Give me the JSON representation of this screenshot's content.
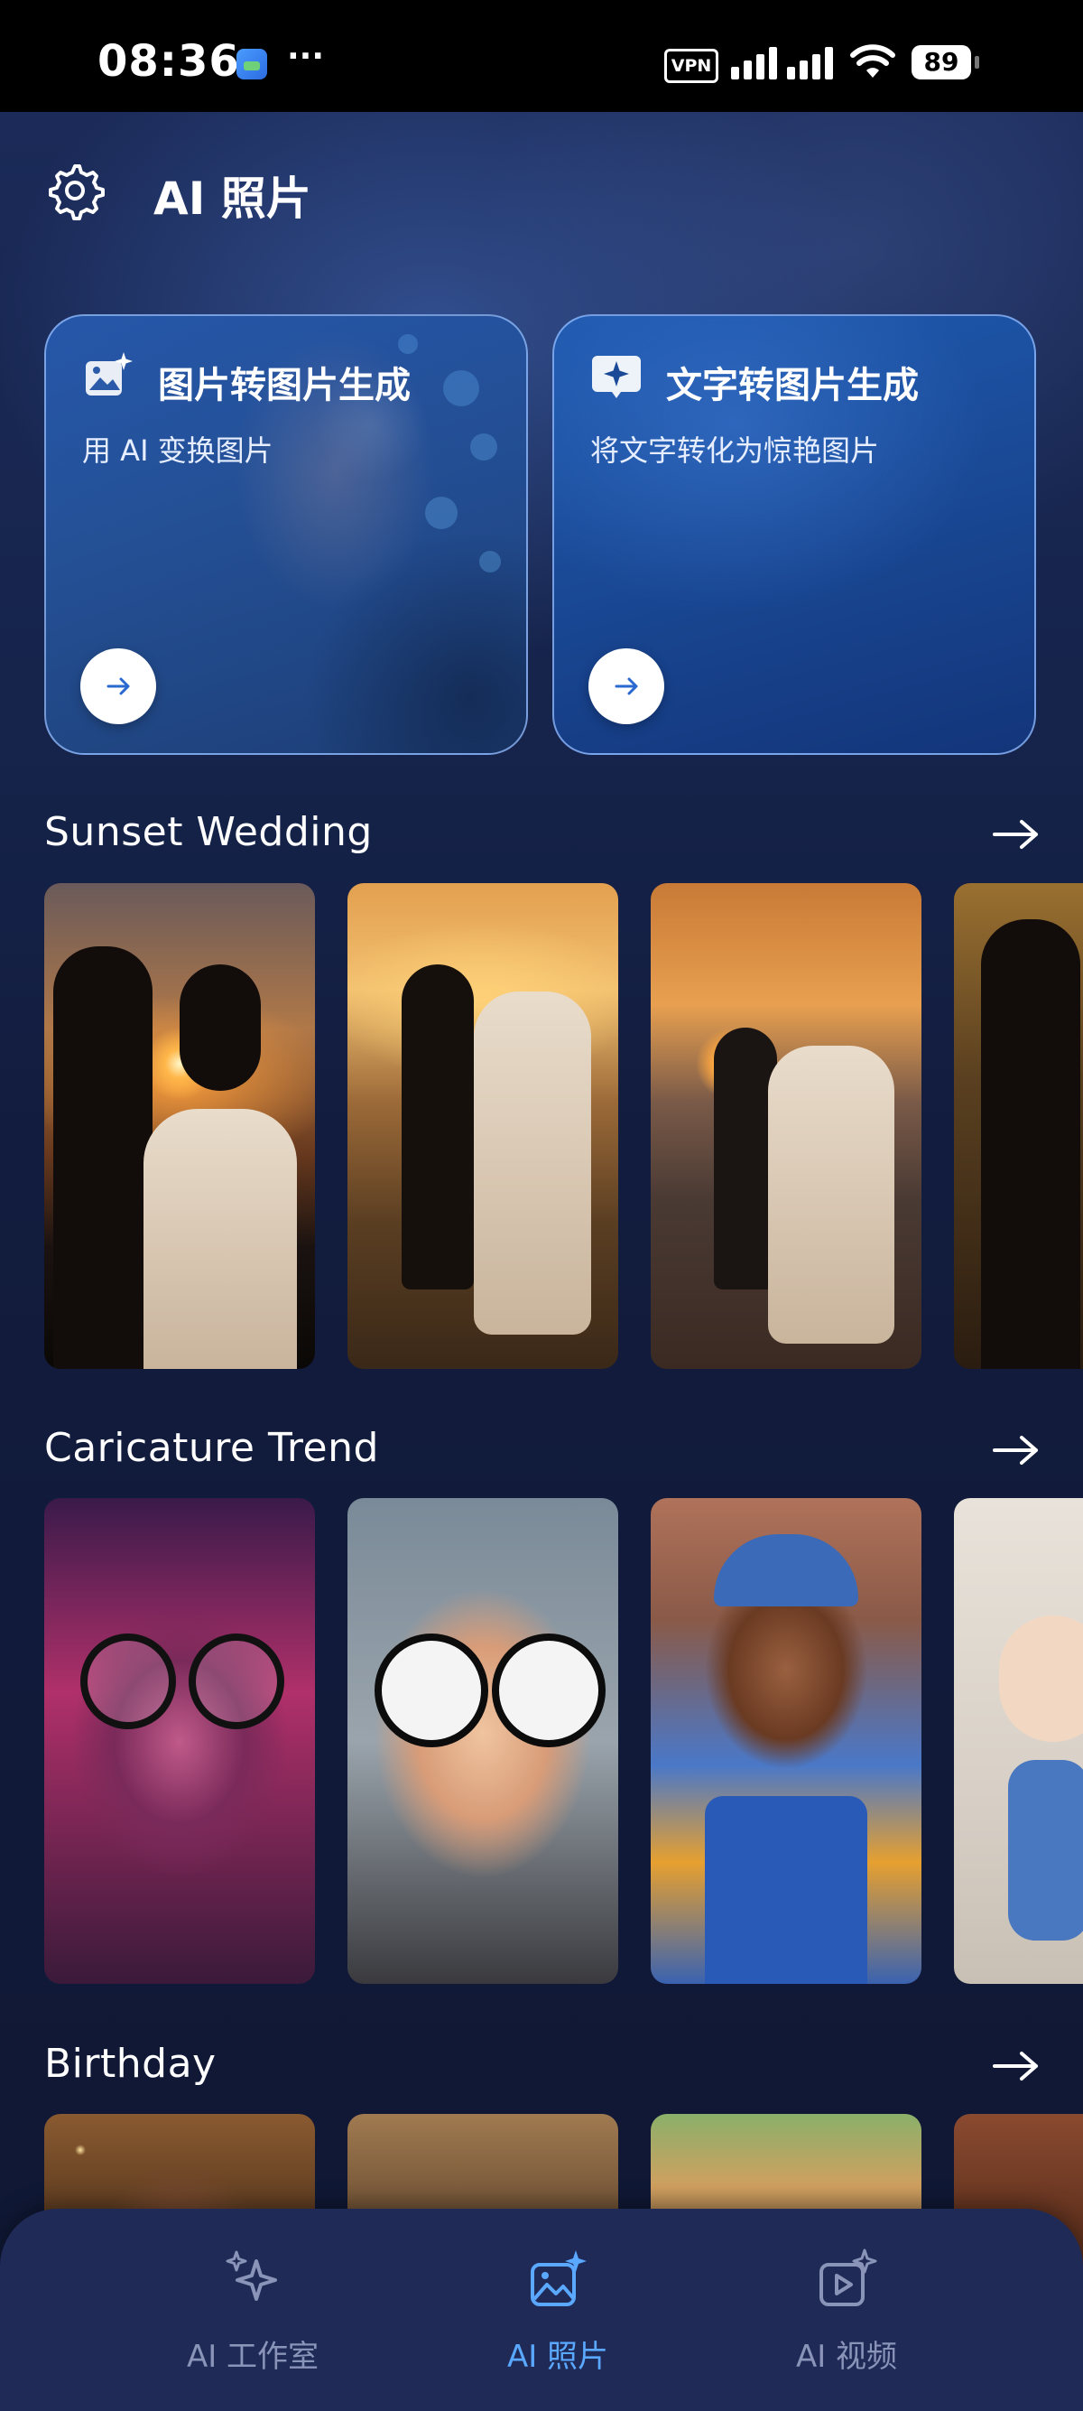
{
  "status_bar": {
    "time": "08:36",
    "more_indicator": "···",
    "vpn_label": "VPN",
    "battery_level": "89",
    "icons": [
      "app-notification-icon",
      "vpn-icon",
      "signal-icon",
      "wifi-icon",
      "battery-icon"
    ]
  },
  "header": {
    "title": "AI 照片",
    "settings_icon": "gear-icon"
  },
  "feature_cards": [
    {
      "title": "图片转图片生成",
      "subtitle": "用 AI 变换图片",
      "icon": "image-sparkle-icon",
      "action_icon": "arrow-right-icon"
    },
    {
      "title": "文字转图片生成",
      "subtitle": "将文字转化为惊艳图片",
      "icon": "chat-sparkle-icon",
      "action_icon": "arrow-right-icon"
    }
  ],
  "sections": [
    {
      "title": "Sunset Wedding",
      "see_all_icon": "arrow-right-icon",
      "tile_count": 4
    },
    {
      "title": "Caricature Trend",
      "see_all_icon": "arrow-right-icon",
      "tile_count": 4
    },
    {
      "title": "Birthday",
      "see_all_icon": "arrow-right-icon",
      "tile_count": 4
    }
  ],
  "bottom_nav": {
    "items": [
      {
        "label": "AI 工作室",
        "icon": "sparkles-icon",
        "active": false
      },
      {
        "label": "AI 照片",
        "icon": "image-sparkle-icon",
        "active": true
      },
      {
        "label": "AI 视频",
        "icon": "video-sparkle-icon",
        "active": false
      }
    ]
  },
  "colors": {
    "background": "#101a38",
    "accent_active": "#5aa8ff",
    "inactive_nav": "#8a93b8",
    "card_border": "#96beff"
  }
}
